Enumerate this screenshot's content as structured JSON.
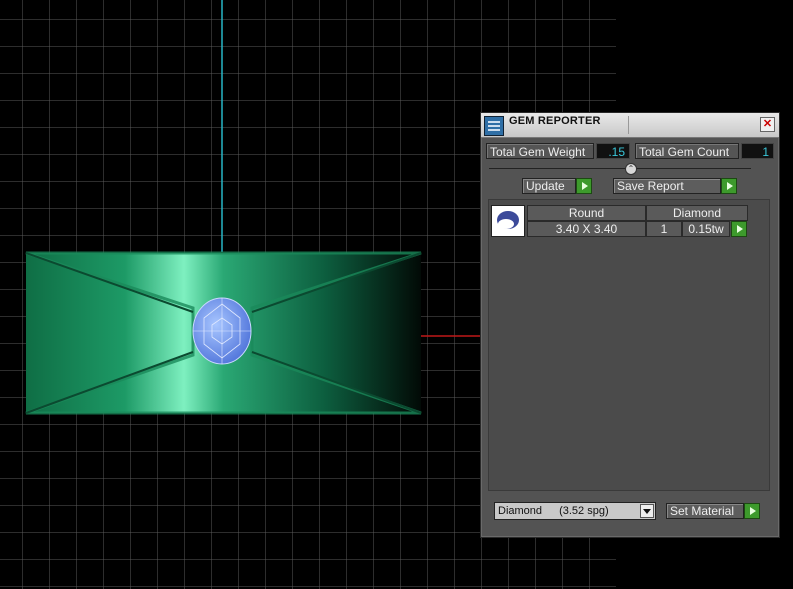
{
  "colors": {
    "accent": "#39c6d8",
    "go_button": "#3d9a2c",
    "panel_bg": "#535353"
  },
  "panel": {
    "title": "GEM REPORTER",
    "close_icon": "close-icon",
    "total_weight_label": "Total Gem Weight",
    "total_weight_value": ".15",
    "total_count_label": "Total Gem Count",
    "total_count_value": "1",
    "update_label": "Update",
    "save_report_label": "Save Report",
    "table": {
      "headers": [
        "Round",
        "Diamond"
      ],
      "rows": [
        {
          "size": "3.40 X 3.40",
          "count": "1",
          "weight": "0.15tw"
        }
      ]
    },
    "material_select": {
      "value": "Diamond",
      "density": "(3.52 spg)"
    },
    "set_material_label": "Set Material"
  }
}
